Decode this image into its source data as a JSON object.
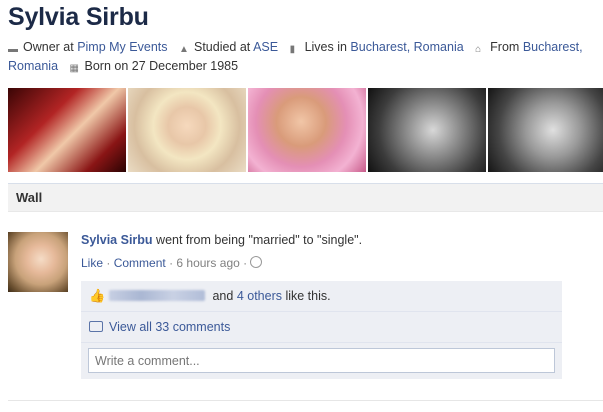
{
  "profile": {
    "name": "Sylvia Sirbu",
    "info": [
      {
        "icon": "briefcase-icon",
        "prefix": "Owner at ",
        "link": "Pimp My Events"
      },
      {
        "icon": "graduation-cap-icon",
        "prefix": "Studied at ",
        "link": "ASE"
      },
      {
        "icon": "location-icon",
        "prefix": "Lives in ",
        "link": "Bucharest, Romania"
      },
      {
        "icon": "home-icon",
        "prefix": "From ",
        "link": "Bucharest, Romania"
      },
      {
        "icon": "calendar-icon",
        "prefix": "Born on 27 December 1985",
        "link": ""
      }
    ]
  },
  "wall": {
    "title": "Wall"
  },
  "post": {
    "actor": "Sylvia Sirbu",
    "text": " went from being \"married\" to \"single\".",
    "like_label": "Like",
    "comment_label": "Comment",
    "timestamp": "6 hours ago",
    "likes_text_mid": " and ",
    "likes_others": "4 others",
    "likes_text_end": " like this.",
    "view_comments": "View all 33 comments",
    "comment_placeholder": "Write a comment..."
  }
}
